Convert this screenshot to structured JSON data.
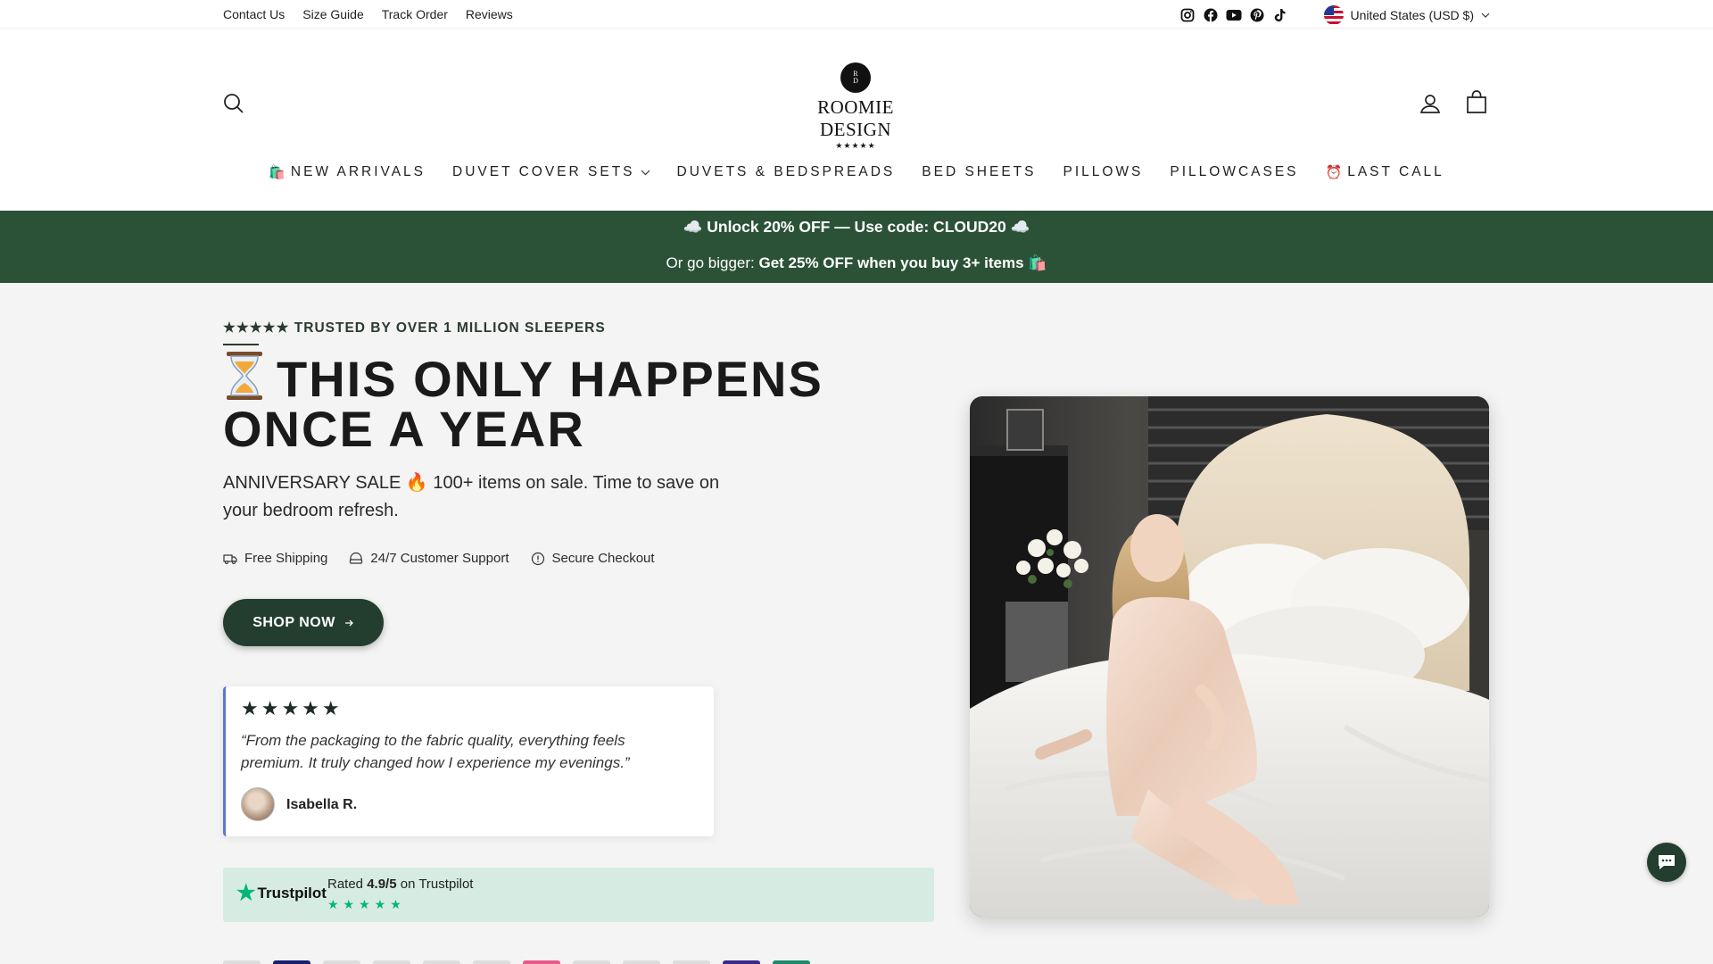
{
  "utility": {
    "links": [
      "Contact Us",
      "Size Guide",
      "Track Order",
      "Reviews"
    ],
    "social_icons": [
      "instagram-icon",
      "facebook-icon",
      "youtube-icon",
      "pinterest-icon",
      "tiktok-icon"
    ],
    "currency": "United States (USD $)"
  },
  "header": {
    "logo_badge": "R\nD",
    "logo_name": "ROOMIE DESIGN",
    "logo_stars": "★★★★★"
  },
  "nav": {
    "items": [
      {
        "emoji": "🛍️",
        "label": "NEW ARRIVALS"
      },
      {
        "emoji": "",
        "label": "DUVET COVER SETS"
      },
      {
        "emoji": "",
        "label": "DUVETS & BEDSPREADS"
      },
      {
        "emoji": "",
        "label": "BED SHEETS"
      },
      {
        "emoji": "",
        "label": "PILLOWS"
      },
      {
        "emoji": "",
        "label": "PILLOWCASES"
      },
      {
        "emoji": "⏰",
        "label": "LAST CALL"
      }
    ]
  },
  "promo": {
    "line1": "☁️ Unlock 20% OFF — Use code: CLOUD20 ☁️",
    "line2_prefix": "Or go bigger: ",
    "line2_bold": "Get 25% OFF when you buy 3+ items 🛍️"
  },
  "hero": {
    "eyebrow": "★★★★★ TRUSTED BY OVER 1 MILLION SLEEPERS",
    "title": "THIS ONLY HAPPENS ONCE A YEAR",
    "subtitle": "ANNIVERSARY SALE 🔥 100+ items on sale. Time to save on your bedroom refresh.",
    "features": [
      "Free Shipping",
      "24/7 Customer Support",
      "Secure Checkout"
    ],
    "cta": "SHOP NOW"
  },
  "review": {
    "stars": "★★★★★",
    "quote": "“From the packaging to the fabric quality, everything feels premium. It truly changed how I experience my evenings.”",
    "name": "Isabella R."
  },
  "trustpilot": {
    "brand": "Trustpilot",
    "rated_prefix": "Rated ",
    "score": "4.9/5",
    "rated_suffix": " on Trustpilot",
    "stars": "★★★★★"
  },
  "colors": {
    "promo_bg": "#2b5236",
    "button_bg": "#233e2f",
    "trustpilot_green": "#00b67a",
    "trustpilot_bg": "#d6ece2"
  }
}
